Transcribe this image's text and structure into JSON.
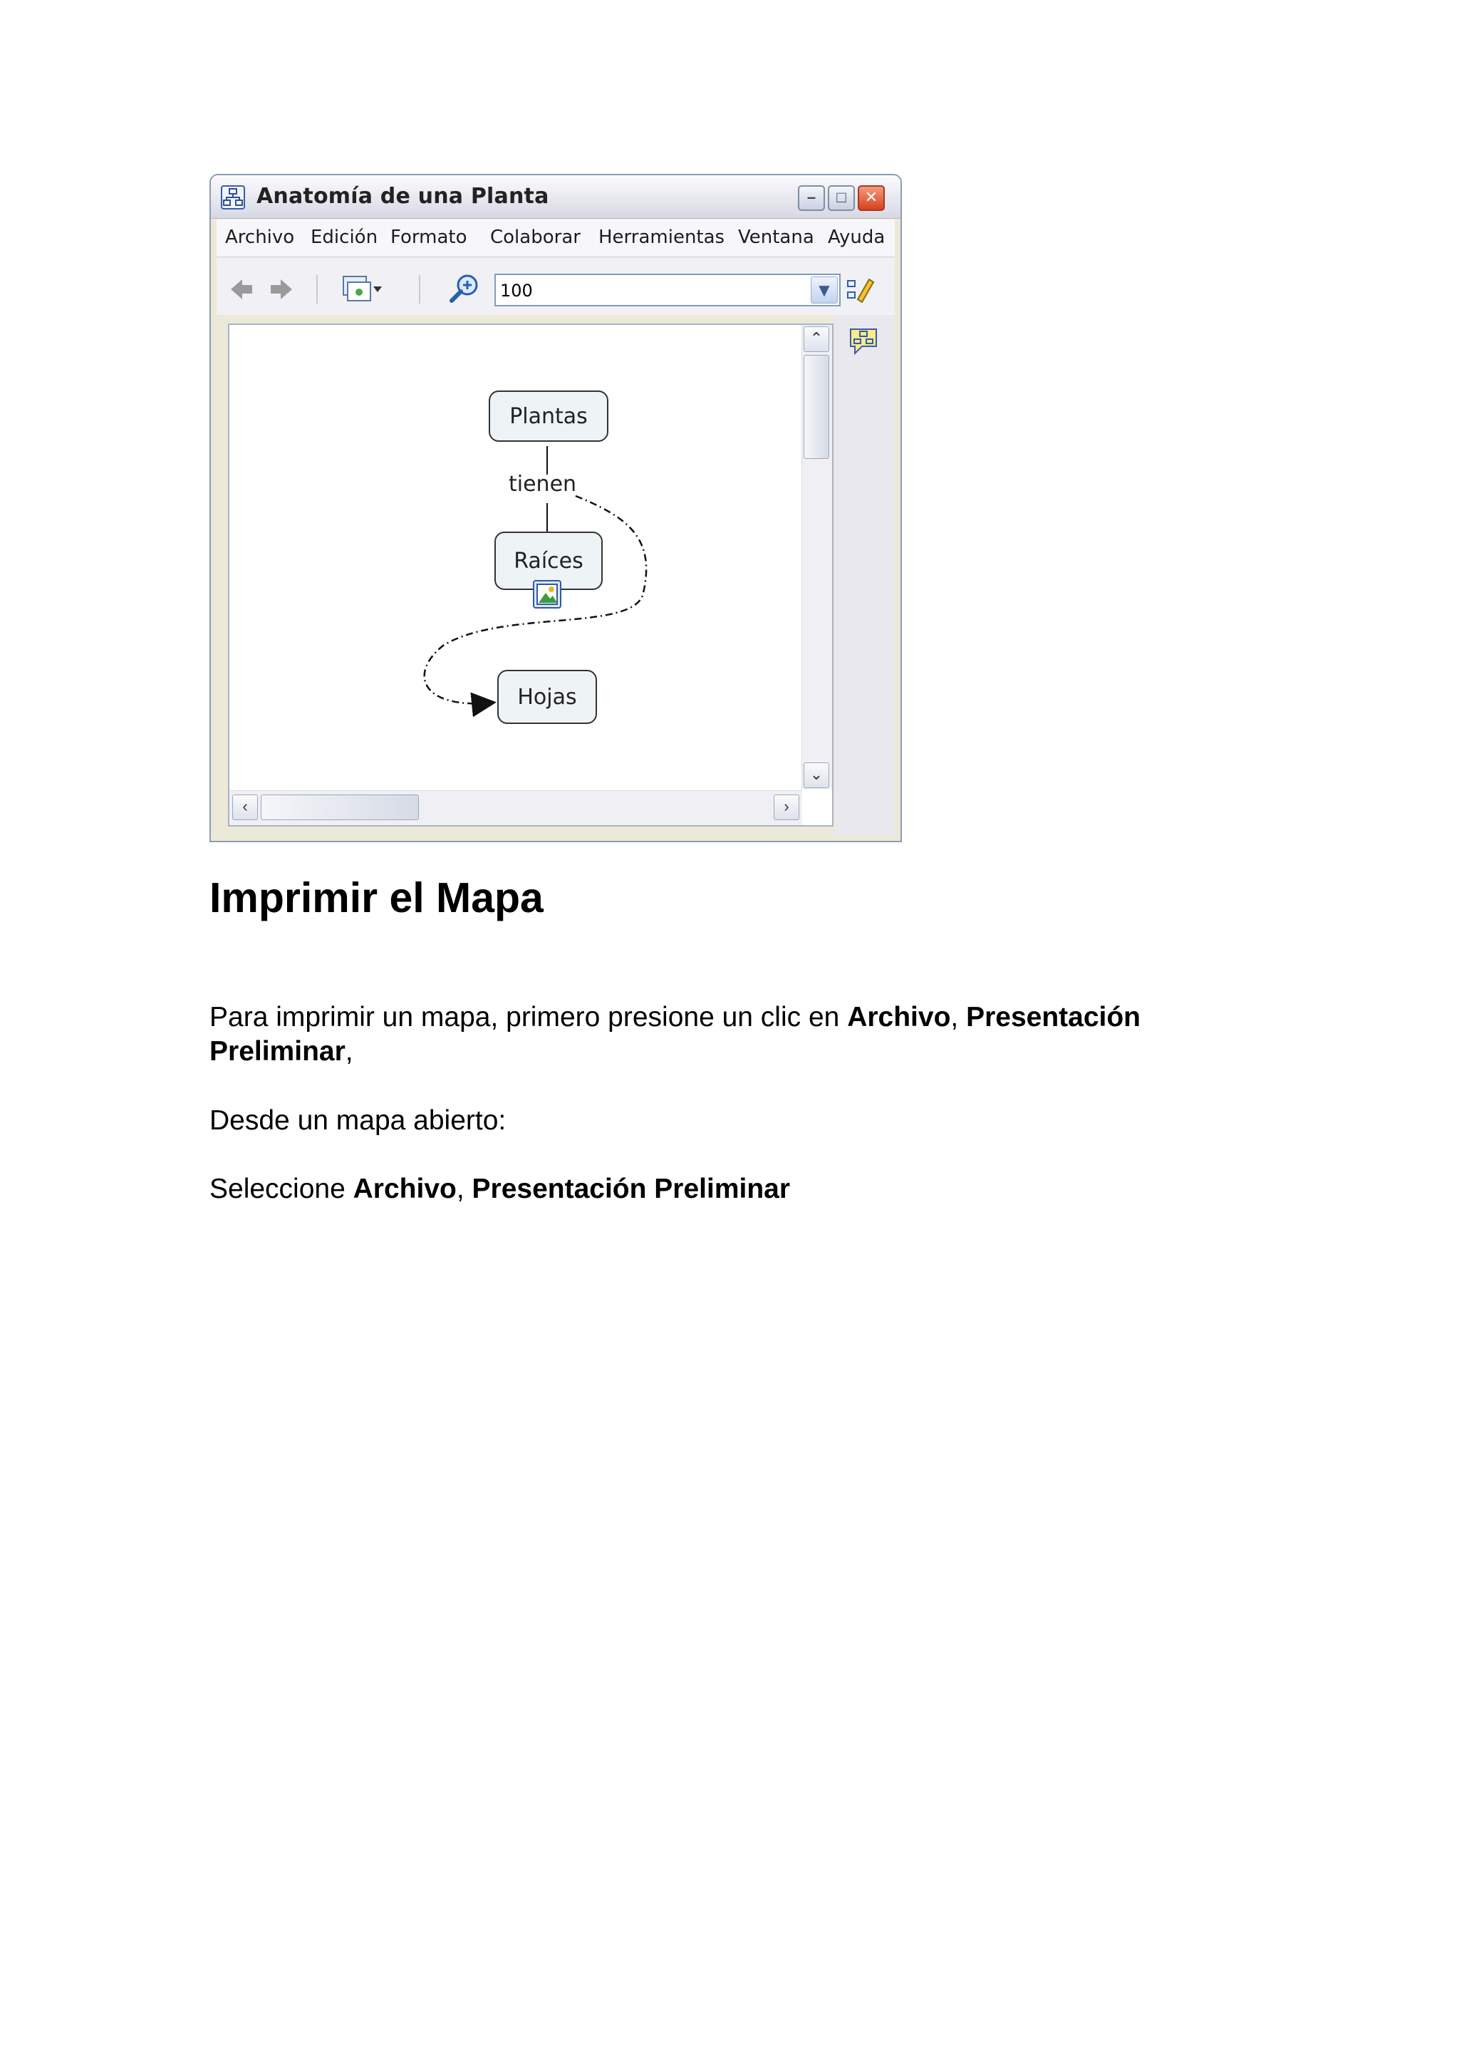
{
  "window": {
    "title": "Anatomía de una Planta",
    "minimize": "–",
    "maximize": "□",
    "close": "✕"
  },
  "menu": [
    "Archivo",
    "Edición",
    "Formato",
    "Colaborar",
    "Herramientas",
    "Ventana",
    "Ayuda"
  ],
  "toolbar": {
    "zoom_value": "100",
    "back_icon": "back-arrow-icon",
    "forward_icon": "forward-arrow-icon"
  },
  "map": {
    "nodes": {
      "plantas": "Plantas",
      "raices": "Raíces",
      "hojas": "Hojas"
    },
    "link_label": "tienen"
  },
  "document": {
    "heading": "Imprimir el Mapa",
    "p1": {
      "lead": "Para imprimir un mapa, primero presione un clic en ",
      "b1": "Archivo",
      "sep": ", ",
      "b2": "Presentación Preliminar",
      "tail": ","
    },
    "p2": "Desde un mapa abierto:",
    "p3": {
      "lead": "Seleccione ",
      "b1": "Archivo",
      "sep": ", ",
      "b2": "Presentación Preliminar"
    }
  }
}
